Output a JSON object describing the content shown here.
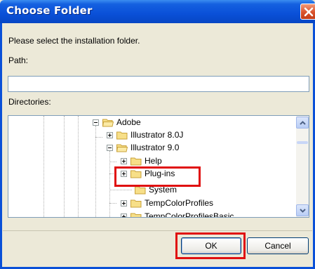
{
  "dialog": {
    "title": "Choose Folder",
    "instruction": "Please select the installation folder.",
    "path_label": "Path:",
    "path_value": "",
    "directories_label": "Directories:"
  },
  "tree": {
    "items": [
      {
        "label": "Adobe",
        "state": "expanded"
      },
      {
        "label": "Illustrator 8.0J",
        "state": "collapsed"
      },
      {
        "label": "Illustrator 9.0",
        "state": "expanded"
      },
      {
        "label": "Help",
        "state": "collapsed"
      },
      {
        "label": "Plug-ins",
        "state": "collapsed"
      },
      {
        "label": "System",
        "state": "leaf"
      },
      {
        "label": "TempColorProfiles",
        "state": "collapsed"
      },
      {
        "label": "TempColorProfilesBasic",
        "state": "collapsed"
      }
    ]
  },
  "buttons": {
    "ok": "OK",
    "cancel": "Cancel"
  },
  "colors": {
    "titlebar": "#0a50d8",
    "highlight_box": "#e01010",
    "dialog_bg": "#ece9d8"
  }
}
